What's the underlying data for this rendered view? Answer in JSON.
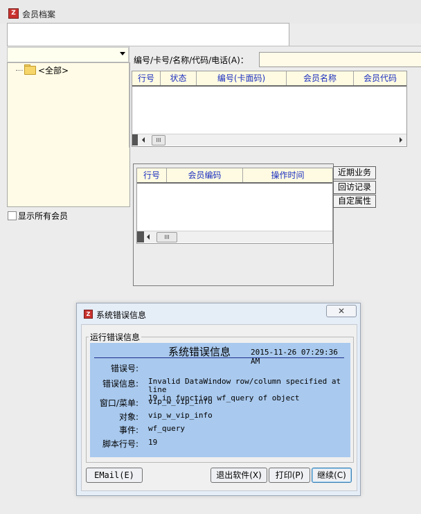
{
  "window": {
    "title": "会员档案",
    "icon": "app-icon"
  },
  "tree": {
    "root_label": "<全部>"
  },
  "show_all_label": "显示所有会员",
  "search": {
    "label": "编号/卡号/名称/代码/电话(A)：",
    "value": ""
  },
  "grid1": {
    "columns": [
      "行号",
      "状态",
      "编号(卡面码)",
      "会员名称",
      "会员代码"
    ],
    "scroll_thumb": "III"
  },
  "grid2": {
    "columns": [
      "行号",
      "会员编码",
      "操作时间"
    ],
    "scroll_thumb": "III"
  },
  "side_tabs": [
    "近期业务",
    "回访记录",
    "自定属性"
  ],
  "dialog": {
    "title": "系统错误信息",
    "close_label": "✕",
    "group_label": "运行错误信息",
    "info_title": "系统错误信息",
    "timestamp": "2015-11-26 07:29:36 AM",
    "fields": [
      {
        "label": "错误号:",
        "value": ""
      },
      {
        "label": "错误信息:",
        "value": "Invalid DataWindow row/column specified at line\n19 in function wf_query of object"
      },
      {
        "label": "窗口/菜单:",
        "value": "vip_w_vip_info"
      },
      {
        "label": "对象:",
        "value": "vip_w_vip_info"
      },
      {
        "label": "事件:",
        "value": "wf_query"
      },
      {
        "label": "脚本行号:",
        "value": "19"
      }
    ],
    "buttons": {
      "email": "EMail(E)",
      "exit": "退出软件(X)",
      "print": "打印(P)",
      "continue": "继续(C)"
    }
  },
  "colors": {
    "info_panel": "#a9c9ee",
    "grid_header_text": "#1b2fbf",
    "tree_background": "#fffbe6"
  }
}
